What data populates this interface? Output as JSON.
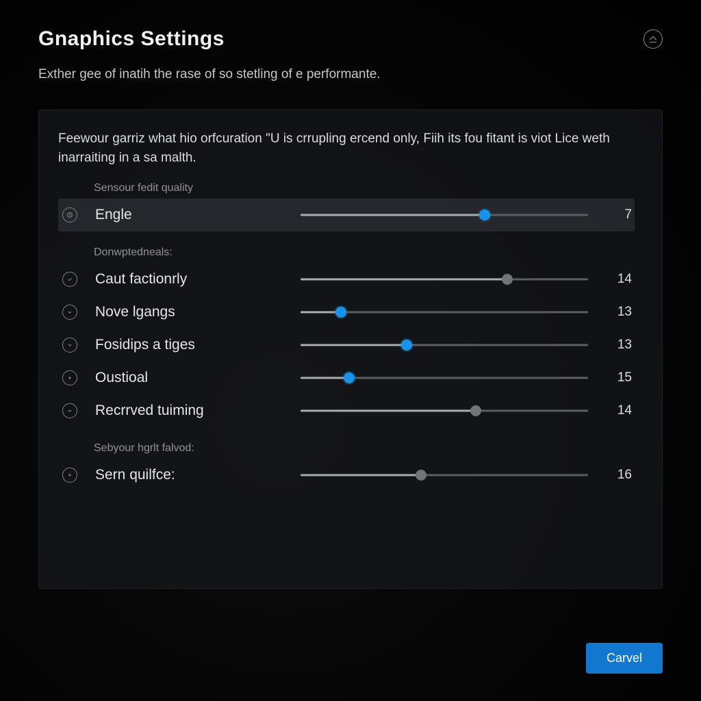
{
  "header": {
    "title": "Gnaphics Settings",
    "subtitle": "Exther gee of inatih the rase of so stetling of e performante."
  },
  "panel": {
    "description": "Feewour garriz what hio orfcuration \"U is crrupling ercend only, Fiih its fou fitant is viot Lice weth inarraiting in a sa malth."
  },
  "groups": [
    {
      "label": "Sensour fedit quality",
      "rows": [
        {
          "icon": "clock",
          "label": "Engle",
          "value": 7,
          "pos": 64,
          "thumb": "blue",
          "highlight": true
        }
      ]
    },
    {
      "label": "Donwptedneals:",
      "rows": [
        {
          "icon": "check",
          "label": "Caut factionrly",
          "value": 14,
          "pos": 72,
          "thumb": "grey",
          "highlight": false
        },
        {
          "icon": "down",
          "label": "Nove lgangs",
          "value": 13,
          "pos": 14,
          "thumb": "blue",
          "highlight": false
        },
        {
          "icon": "down",
          "label": "Fosidips a tiges",
          "value": 13,
          "pos": 37,
          "thumb": "blue",
          "highlight": false
        },
        {
          "icon": "plus",
          "label": "Oustioal",
          "value": 15,
          "pos": 17,
          "thumb": "blue",
          "highlight": false
        },
        {
          "icon": "down",
          "label": "Recrrved tuiming",
          "value": 14,
          "pos": 61,
          "thumb": "grey",
          "highlight": false
        }
      ]
    },
    {
      "label": "Sebyour hgrlt falvod:",
      "rows": [
        {
          "icon": "plus",
          "label": "Sern quilfce:",
          "value": 16,
          "pos": 42,
          "thumb": "grey",
          "highlight": false
        }
      ]
    }
  ],
  "footer": {
    "primary_label": "Carvel"
  },
  "colors": {
    "accent": "#1893e8",
    "primary_button": "#1177cf"
  }
}
